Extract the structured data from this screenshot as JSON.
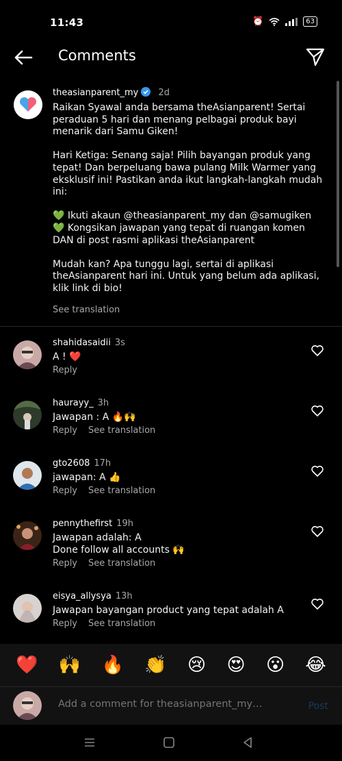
{
  "status_bar": {
    "time": "11:43",
    "battery": "63"
  },
  "header": {
    "title": "Comments"
  },
  "caption": {
    "username": "theasianparent_my",
    "time": "2d",
    "text": "Raikan Syawal anda bersama theAsianparent! Sertai peraduan 5 hari dan menang pelbagai produk bayi menarik dari Samu Giken!\n\nHari Ketiga: Senang saja! Pilih bayangan produk yang tepat! Dan berpeluang bawa pulang Milk Warmer yang eksklusif ini! Pastikan anda ikut langkah-langkah mudah ini:\n\n💚 Ikuti akaun @theasianparent_my dan @samugiken\n💚 Kongsikan jawapan yang tepat di ruangan komen DAN di post rasmi aplikasi theAsianparent\n\nMudah kan? Apa tunggu lagi, sertai di aplikasi theAsianparent hari ini. Untuk yang belum ada aplikasi, klik link di bio!",
    "see_translation": "See translation"
  },
  "comments": [
    {
      "username": "shahidasaidii",
      "time": "3s",
      "text": "A ! ❤️",
      "reply": "Reply",
      "see_translation": ""
    },
    {
      "username": "haurayy_",
      "time": "3h",
      "text": "Jawapan : A 🔥🙌",
      "reply": "Reply",
      "see_translation": "See translation"
    },
    {
      "username": "gto2608",
      "time": "17h",
      "text": "jawapan: A 👍",
      "reply": "Reply",
      "see_translation": "See translation"
    },
    {
      "username": "pennythefirst",
      "time": "19h",
      "text": "Jawapan adalah: A\nDone follow all accounts 🙌",
      "reply": "Reply",
      "see_translation": "See translation"
    },
    {
      "username": "eisya_allysya",
      "time": "13h",
      "text": "Jawapan bayangan product yang tepat adalah A",
      "reply": "Reply",
      "see_translation": "See translation"
    }
  ],
  "emoji_bar": [
    "❤️",
    "🙌",
    "🔥",
    "👏",
    "😢",
    "😍",
    "😮",
    "😂"
  ],
  "input": {
    "placeholder": "Add a comment for theasianparent_my…",
    "post_label": "Post"
  },
  "colors": {
    "background": "#000000",
    "secondary_text": "#a8a8a8",
    "verified": "#3897f0",
    "post_disabled": "#1a3a5c"
  }
}
